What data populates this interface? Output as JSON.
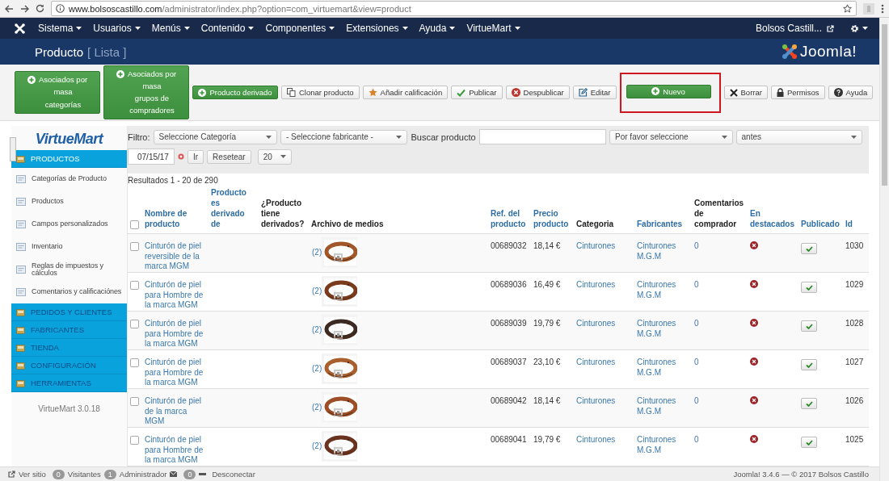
{
  "browser": {
    "url_host": "www.bolsoscastillo.com",
    "url_path": "/administrator/index.php?option=com_virtuemart&view=product"
  },
  "nav": {
    "menus": [
      "Sistema",
      "Usuarios",
      "Menús",
      "Contenido",
      "Componentes",
      "Extensiones",
      "Ayuda",
      "VirtueMart"
    ],
    "user": "Bolsos Castill..."
  },
  "header": {
    "title": "Producto",
    "subtitle": "[ Lista ]",
    "logo_text": "Joomla!"
  },
  "toolbar": {
    "buttons": [
      {
        "label": "Asociados por\nmasa\ncategorías",
        "kind": "success",
        "highlighted": false
      },
      {
        "label": "Asociados por\nmasa\ngrupos de\ncompradores",
        "kind": "success",
        "highlighted": false
      },
      {
        "label": "Producto derivado",
        "kind": "success",
        "highlighted": false
      },
      {
        "label": "Clonar producto",
        "kind": "default",
        "highlighted": false
      },
      {
        "label": "Añadir calificación",
        "kind": "default",
        "highlighted": false
      },
      {
        "label": "Publicar",
        "kind": "default",
        "highlighted": false
      },
      {
        "label": "Despublicar",
        "kind": "default",
        "highlighted": false
      },
      {
        "label": "Editar",
        "kind": "default",
        "highlighted": false
      },
      {
        "label": "Nuevo",
        "kind": "success",
        "highlighted": true
      },
      {
        "label": "Borrar",
        "kind": "default",
        "highlighted": false
      },
      {
        "label": "Permisos",
        "kind": "default",
        "highlighted": false
      },
      {
        "label": "Ayuda",
        "kind": "default",
        "highlighted": false
      }
    ]
  },
  "sidebar": {
    "logo": "VirtueMart",
    "version": "VirtueMart 3.0.18",
    "sections": [
      {
        "label": "PRODUCTOS",
        "selected": true,
        "items": [
          "Categorías de Producto",
          "Productos",
          "Campos personalizados",
          "Inventario",
          "Reglas de impuestos y cálculos",
          "Comentarios y calificaciónes"
        ]
      },
      {
        "label": "PEDIDOS Y CLIENTES",
        "selected": false
      },
      {
        "label": "FABRICANTES",
        "selected": false
      },
      {
        "label": "TIENDA",
        "selected": false
      },
      {
        "label": "CONFIGURACIÓN",
        "selected": false
      },
      {
        "label": "HERRAMIENTAS",
        "selected": false
      }
    ]
  },
  "filters": {
    "label": "Filtro:",
    "category": "Seleccione Categoría",
    "manufacturer": "- Seleccione fabricante -",
    "search_label": "Buscar producto",
    "date_mode": "Por favor seleccione",
    "date_relation": "antes",
    "date": "07/15/17",
    "go": "Ir",
    "reset": "Resetear",
    "page_size": "20",
    "results": "Resultados 1 - 20 de 290"
  },
  "table": {
    "select_all_checked": false,
    "columns": [
      {
        "label": "Nombre de\nproducto",
        "sortable": true
      },
      {
        "label": "Producto\nes\nderivado\nde",
        "sortable": true
      },
      {
        "label": "¿Producto\ntiene\nderivados?",
        "sortable": false
      },
      {
        "label": "Archivo de medios",
        "sortable": false
      },
      {
        "label": "Ref. del\nproducto",
        "sortable": true
      },
      {
        "label": "Precio\nproducto",
        "sortable": true
      },
      {
        "label": "Categoria",
        "sortable": false
      },
      {
        "label": "Fabricantes",
        "sortable": true
      },
      {
        "label": "Comentarios\nde\ncomprador",
        "sortable": false
      },
      {
        "label": "En\ndestacados",
        "sortable": true
      },
      {
        "label": "Publicado",
        "sortable": true
      },
      {
        "label": "Id",
        "sortable": true
      }
    ],
    "rows": [
      {
        "checked": false,
        "name": "Cinturón de piel reversible de la marca MGM",
        "media": "(2)",
        "ref": "00689032",
        "price": "18,14 €",
        "category": "Cinturones",
        "manufacturer": "Cinturones M.G.M",
        "comments": "0",
        "featured": false,
        "published": true,
        "id": "1030"
      },
      {
        "checked": false,
        "name": "Cinturón de piel para Hombre de la marca MGM",
        "media": "(2)",
        "ref": "00689036",
        "price": "16,49 €",
        "category": "Cinturones",
        "manufacturer": "Cinturones M.G.M",
        "comments": "0",
        "featured": false,
        "published": true,
        "id": "1029"
      },
      {
        "checked": false,
        "name": "Cinturón de piel para Hombre de la marca MGM",
        "media": "(2)",
        "ref": "00689039",
        "price": "19,79 €",
        "category": "Cinturones",
        "manufacturer": "Cinturones M.G.M",
        "comments": "0",
        "featured": false,
        "published": true,
        "id": "1028"
      },
      {
        "checked": false,
        "name": "Cinturón de piel para Hombre de la marca MGM",
        "media": "(2)",
        "ref": "00689037",
        "price": "23,10 €",
        "category": "Cinturones",
        "manufacturer": "Cinturones M.G.M",
        "comments": "0",
        "featured": false,
        "published": true,
        "id": "1027"
      },
      {
        "checked": false,
        "name": "Cinturón de piel de la marca MGM",
        "media": "(2)",
        "ref": "00689042",
        "price": "18,14 €",
        "category": "Cinturones",
        "manufacturer": "Cinturones M.G.M",
        "comments": "0",
        "featured": false,
        "published": true,
        "id": "1026"
      },
      {
        "checked": false,
        "name": "Cinturón de piel para Hombre de la marca MGM",
        "media": "(2)",
        "ref": "00689041",
        "price": "19,79 €",
        "category": "Cinturones",
        "manufacturer": "Cinturones M.G.M",
        "comments": "0",
        "featured": false,
        "published": true,
        "id": "1025"
      }
    ]
  },
  "status_bar": {
    "view_site": "Ver sitio",
    "visitors_count": "0",
    "visitors": "Visitantes",
    "admins_count": "1",
    "admins": "Administrador",
    "messages_count": "0",
    "logout": "Desconectar",
    "footer": "Joomla! 3.4.6 — © 2017 Bolsos Castillo"
  }
}
